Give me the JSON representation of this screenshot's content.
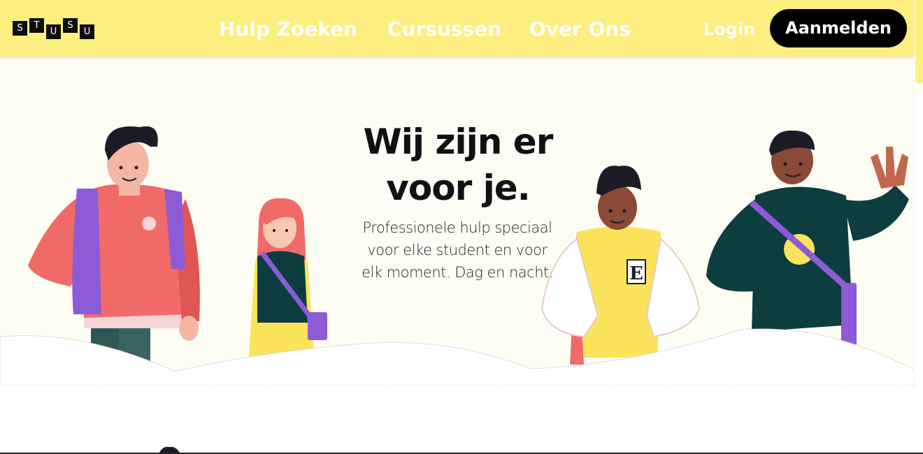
{
  "logo": {
    "letters": [
      "S",
      "T",
      "U",
      "S",
      "U"
    ]
  },
  "nav": {
    "items": [
      {
        "label": "Hulp Zoeken"
      },
      {
        "label": "Cursussen"
      },
      {
        "label": "Over Ons"
      }
    ],
    "login_label": "Login",
    "signup_label": "Aanmelden"
  },
  "hero": {
    "headline_line1": "Wij zijn er",
    "headline_line2": "voor je.",
    "subtext": "Professionele hulp speciaal voor elke student en voor elk moment. Dag en nacht."
  },
  "colors": {
    "header_bg": "#fdef7f",
    "hero_bg": "#fefdf3",
    "button_bg": "#000000",
    "accent_red": "#f06a68",
    "accent_purple": "#8e5bd6",
    "accent_teal": "#0e3d3f",
    "accent_yellow": "#fbe35b"
  },
  "icons": [
    "logo-mark",
    "student-illustrations"
  ]
}
